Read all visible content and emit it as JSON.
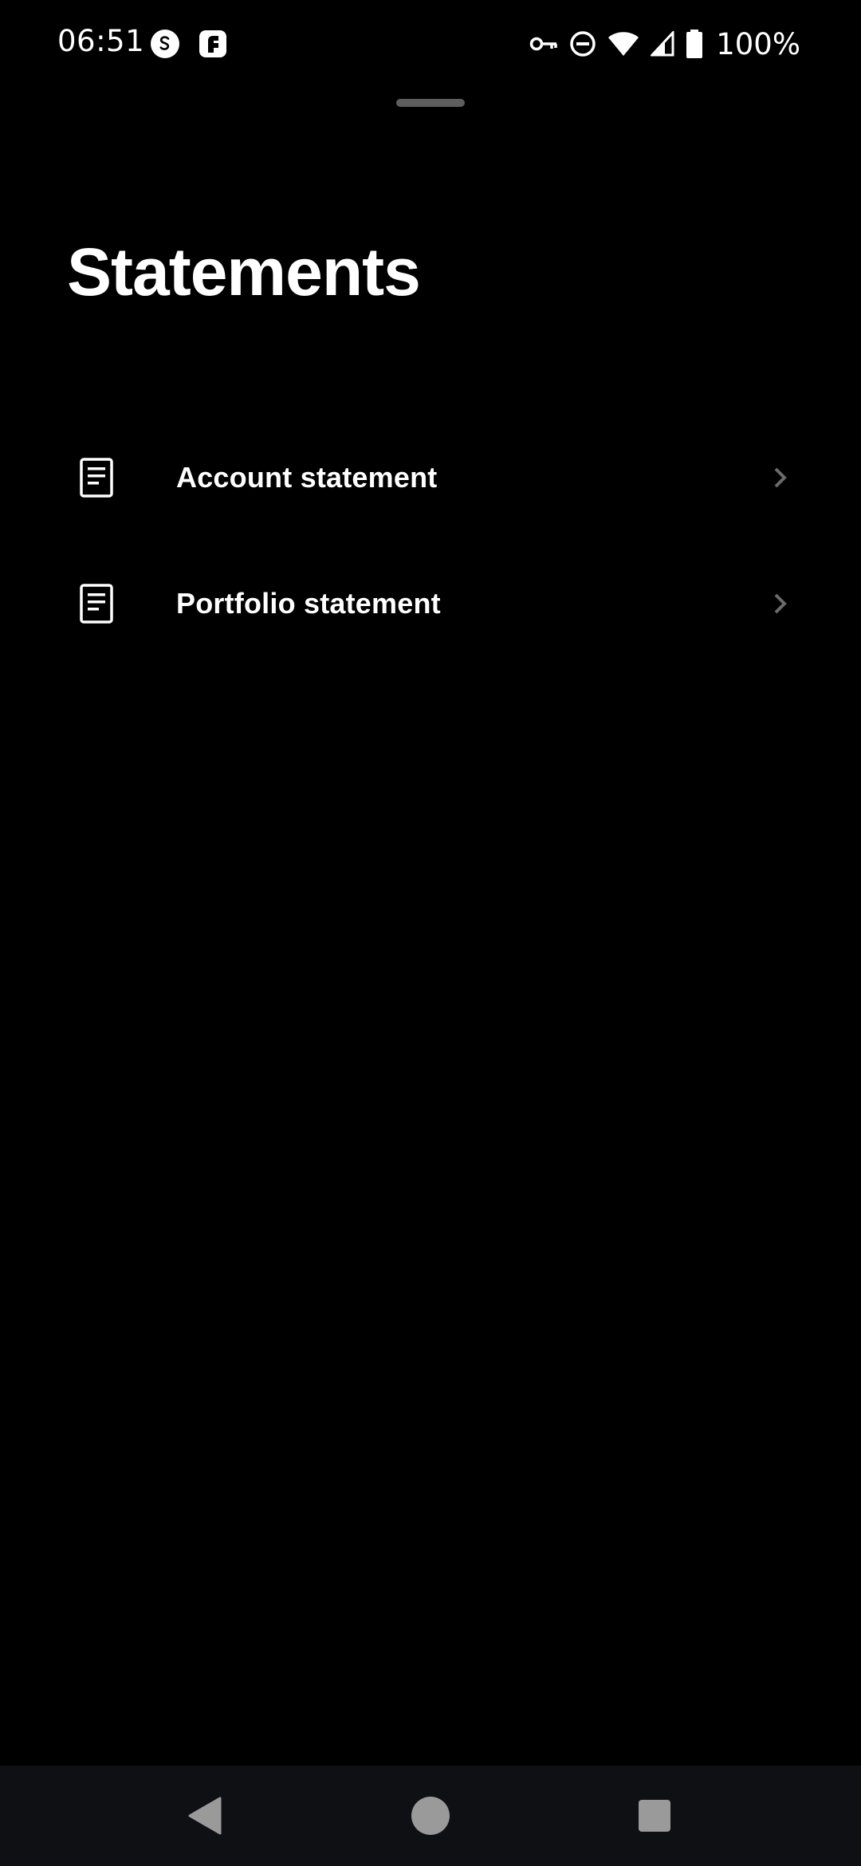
{
  "status_bar": {
    "time": "06:51",
    "battery": "100%",
    "icons": [
      "shazam-icon",
      "fetch-icon",
      "vpn-key-icon",
      "do-not-disturb-icon",
      "wifi-icon",
      "cell-signal-icon",
      "battery-icon"
    ]
  },
  "page": {
    "title": "Statements"
  },
  "items": [
    {
      "label": "Account statement",
      "icon": "document-icon"
    },
    {
      "label": "Portfolio statement",
      "icon": "document-icon"
    }
  ],
  "nav_bar": {
    "buttons": [
      "back",
      "home",
      "recents"
    ]
  },
  "colors": {
    "background": "#000000",
    "text": "#ffffff",
    "chevron": "#6b6b6b",
    "handle": "#5e5e5e",
    "nav_bar": "#0f1014",
    "nav_icon": "#9a9a9a"
  }
}
